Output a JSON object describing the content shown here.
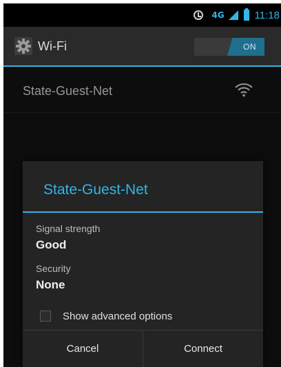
{
  "status_bar": {
    "network_type": "4G",
    "time": "11:18"
  },
  "action_bar": {
    "title": "Wi-Fi",
    "toggle_state": "ON"
  },
  "network_list": [
    {
      "name": "State-Guest-Net"
    }
  ],
  "dialog": {
    "title": "State-Guest-Net",
    "signal_label": "Signal strength",
    "signal_value": "Good",
    "security_label": "Security",
    "security_value": "None",
    "advanced_label": "Show advanced options",
    "advanced_checked": false,
    "cancel_label": "Cancel",
    "connect_label": "Connect"
  },
  "colors": {
    "accent": "#33b5e5",
    "background": "#151515",
    "dialog_background": "#242424"
  },
  "icons": [
    "alarm-icon",
    "network-type-icon",
    "cell-signal-icon",
    "battery-icon",
    "settings-gear-icon",
    "wifi-signal-icon"
  ]
}
